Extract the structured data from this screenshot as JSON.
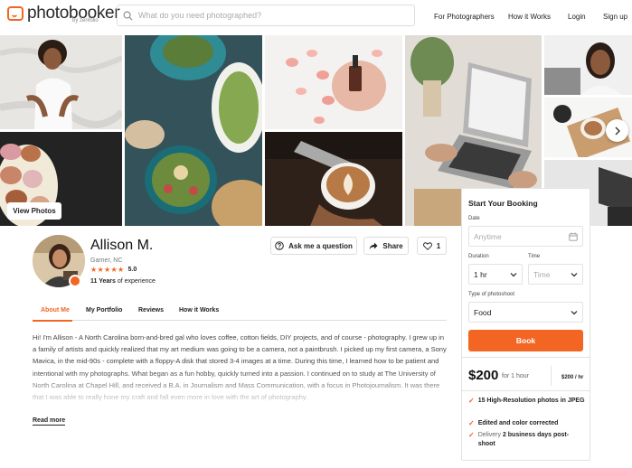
{
  "header": {
    "logo_text": "photobooker",
    "logo_sub": "by zenfolio",
    "search_placeholder": "What do you need photographed?",
    "nav": [
      {
        "label": "For Photographers"
      },
      {
        "label": "How it Works"
      },
      {
        "label": "Login"
      },
      {
        "label": "Sign up"
      }
    ]
  },
  "gallery": {
    "view_photos_label": "View Photos"
  },
  "profile": {
    "name": "Allison M.",
    "location": "Garner, NC",
    "rating": "5.0",
    "stars": 5,
    "experience_years": "11 Years",
    "experience_suffix": " of experience",
    "actions": {
      "ask": "Ask me a question",
      "share": "Share",
      "like_count": "1"
    }
  },
  "tabs": [
    {
      "label": "About Me",
      "active": true
    },
    {
      "label": "My Portfolio",
      "active": false
    },
    {
      "label": "Reviews",
      "active": false
    },
    {
      "label": "How it Works",
      "active": false
    }
  ],
  "bio": {
    "text": "Hi! I'm Allison - A North Carolina born-and-bred gal who loves coffee, cotton fields, DIY projects, and of course - photography. I grew up in a family of artists and quickly realized that my art medium was going to be a camera, not a paintbrush. I picked up my first camera, a Sony Mavica, in the mid-90s - complete with a floppy-A disk that stored 3-4 images at a time. During this time, I learned how to be patient and intentional with my photographs. What began as a fun hobby, quickly turned into a passion. I continued on to study at The University of North Carolina at Chapel Hill, and received a B.A. in Journalism and Mass Communication, with a focus in Photojournalism. It was there that I was able to really hone my craft and fall even more in love with the art of photography.",
    "read_more": "Read more"
  },
  "booking": {
    "title": "Start Your Booking",
    "date_label": "Date",
    "date_placeholder": "Anytime",
    "duration_label": "Duration",
    "duration_value": "1 hr",
    "time_label": "Time",
    "time_value": "Time",
    "type_label": "Type of photoshoot",
    "type_value": "Food",
    "book_label": "Book",
    "price": "$200",
    "price_unit": "for 1 hour",
    "price_rate": "$200 / hr",
    "features": [
      {
        "bold": "15 High-Resolution photos in JPEG",
        "pre": ""
      },
      {
        "bold": "Edited and color corrected",
        "pre": ""
      },
      {
        "bold": "2 business days post-shoot",
        "pre": "Delivery "
      }
    ]
  },
  "colors": {
    "accent": "#f26522"
  }
}
